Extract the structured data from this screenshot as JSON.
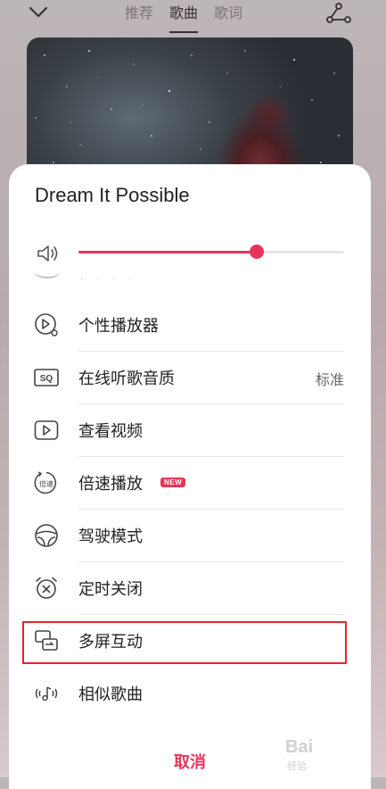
{
  "tabs": [
    {
      "label": "推荐",
      "active": false
    },
    {
      "label": "歌曲",
      "active": true
    },
    {
      "label": "歌词",
      "active": false
    }
  ],
  "sheet": {
    "title": "Dream It Possible",
    "volume": 0.67
  },
  "menu": [
    {
      "label": "个性播放器",
      "icon": "player-skin-icon"
    },
    {
      "label": "在线听歌音质",
      "icon": "sq-quality-icon",
      "value": "标准"
    },
    {
      "label": "查看视频",
      "icon": "play-video-icon"
    },
    {
      "label": "倍速播放",
      "icon": "speed-icon",
      "badge": "NEW",
      "icon_text": "倍速"
    },
    {
      "label": "驾驶模式",
      "icon": "steering-wheel-icon"
    },
    {
      "label": "定时关闭",
      "icon": "alarm-clock-icon"
    },
    {
      "label": "多屏互动",
      "icon": "multi-screen-icon",
      "highlighted": true
    },
    {
      "label": "相似歌曲",
      "icon": "similar-songs-icon"
    }
  ],
  "cancel_label": "取消",
  "colors": {
    "accent": "#e8345a",
    "highlight": "#e0282e"
  },
  "watermark": {
    "brand": "Bai",
    "sub": "经验"
  }
}
